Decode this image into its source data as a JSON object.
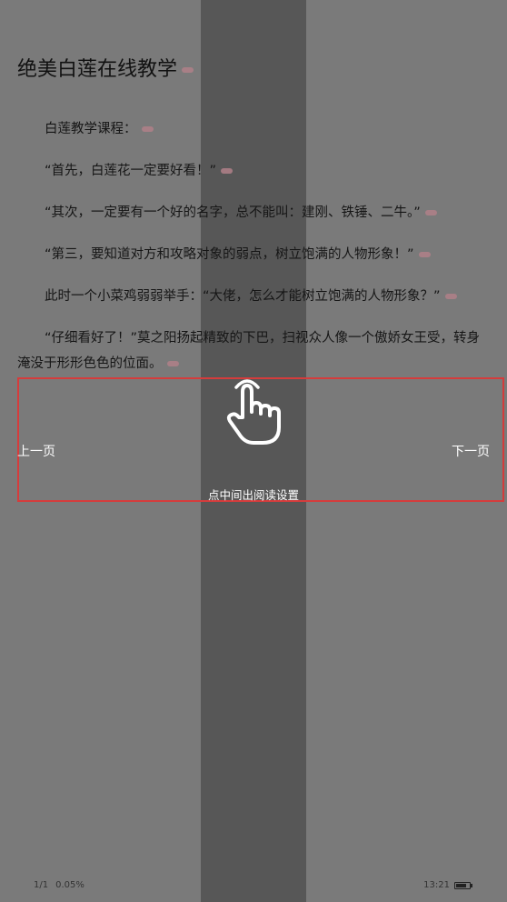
{
  "reader": {
    "chapter_title": "绝美白莲在线教学",
    "paragraphs": [
      "白莲教学课程：",
      "“首先，白莲花一定要好看！”",
      "“其次，一定要有一个好的名字，总不能叫：建刚、铁锤、二牛。”",
      "“第三，要知道对方和攻略对象的弱点，树立饱满的人物形象！”",
      "此时一个小菜鸡弱弱举手：“大佬，怎么才能树立饱满的人物形象？”",
      "“仔细看好了！”莫之阳扬起精致的下巴，扫视众人像一个傲娇女王受，转身淹没于形形色色的位面。"
    ]
  },
  "overlay": {
    "prev_page_label": "上一页",
    "next_page_label": "下一页",
    "center_hint": "点中间出阅读设置",
    "hand_icon": "tap-hand-icon",
    "highlight_color": "#d53c3c"
  },
  "status_bar": {
    "page": "1/1",
    "progress": "0.05%",
    "time": "13:21",
    "battery_icon": "battery-icon"
  }
}
